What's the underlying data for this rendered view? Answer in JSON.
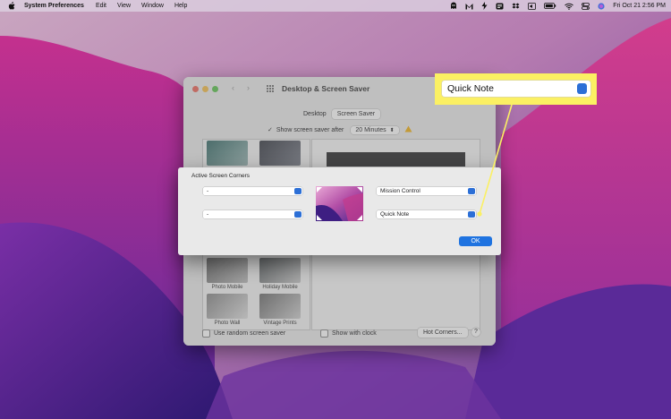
{
  "menu_bar": {
    "app_name": "System Preferences",
    "menus": [
      "Edit",
      "View",
      "Window",
      "Help"
    ],
    "clock": "Fri Oct 21  2:56 PM"
  },
  "prefs_window": {
    "title": "Desktop & Screen Saver",
    "tabs": [
      "Desktop",
      "Screen Saver"
    ],
    "selected_tab": "Screen Saver",
    "show_after_label": "Show screen saver after",
    "show_after_value": "20 Minutes",
    "thumbs": [
      {
        "label": ""
      },
      {
        "label": ""
      },
      {
        "label": "Photo Mobile"
      },
      {
        "label": "Holiday Mobile"
      },
      {
        "label": "Photo Wall"
      },
      {
        "label": "Vintage Prints"
      }
    ],
    "random_label": "Use random screen saver",
    "clock_label": "Show with clock",
    "hot_corners_button": "Hot Corners...",
    "help_button": "?"
  },
  "sheet": {
    "heading": "Active Screen Corners",
    "top_left": "-",
    "bottom_left": "-",
    "top_right": "Mission Control",
    "bottom_right": "Quick Note",
    "ok_button": "OK"
  },
  "callout": {
    "value": "Quick Note",
    "color": "#fbf063"
  }
}
